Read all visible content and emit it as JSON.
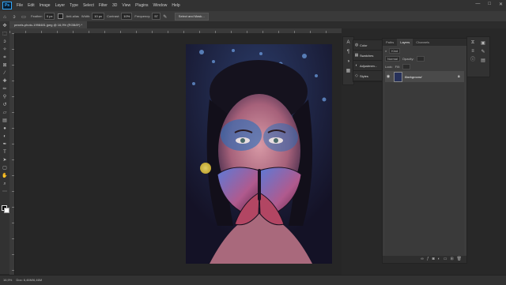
{
  "menubar": {
    "logo": "Ps",
    "items": [
      "File",
      "Edit",
      "Image",
      "Layer",
      "Type",
      "Select",
      "Filter",
      "3D",
      "View",
      "Plugins",
      "Window",
      "Help"
    ],
    "window_controls": [
      "—",
      "□",
      "✕"
    ]
  },
  "options": {
    "feather_label": "Feather:",
    "feather_value": "0 px",
    "antialias_label": "Anti-alias",
    "width_label": "Width:",
    "width_value": "10 px",
    "contrast_label": "Contrast:",
    "contrast_value": "10%",
    "frequency_label": "Frequency:",
    "frequency_value": "57",
    "select_mask_label": "Select and Mask..."
  },
  "document": {
    "tab_title": "pexels-photo-1998481.jpeg @ 16,9% (RGB/8*) *",
    "zoom": "16,9%",
    "doc_info": "Doc: 6,46M/6,46M"
  },
  "libraries": {
    "items": [
      {
        "icon": "color-icon",
        "label": "Color"
      },
      {
        "icon": "swatches-icon",
        "label": "Swatches"
      },
      {
        "icon": "adjustments-icon",
        "label": "Adjustmen..."
      },
      {
        "icon": "styles-icon",
        "label": "Styles"
      }
    ]
  },
  "layers_panel": {
    "tabs": [
      "Paths",
      "Layers",
      "Channels"
    ],
    "active_tab": "Layers",
    "kind_label": "Kind",
    "blend_mode": "Normal",
    "opacity_label": "Opacity:",
    "fill_label": "Fill:",
    "lock_label": "Lock:",
    "layers": [
      {
        "name": "Background",
        "visible": true,
        "locked": true
      }
    ]
  },
  "colors": {
    "fg_swatch": "#000000",
    "bg_swatch": "#ffffff",
    "accent": "#31a8ff"
  }
}
